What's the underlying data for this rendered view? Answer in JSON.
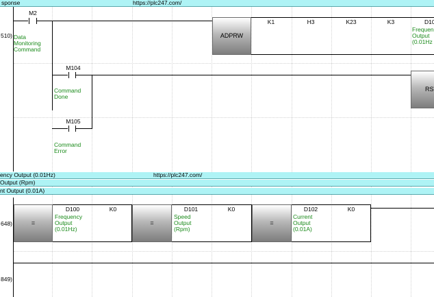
{
  "comment_bands": {
    "top": {
      "left": "sponse",
      "url": "https://plc247.com/"
    },
    "mid1": {
      "left": "ency Output (0.01Hz)",
      "url": "https://plc247.com/"
    },
    "mid2": {
      "left": " Output (Rpm)"
    },
    "mid3": {
      "left": "nt Output (0.01A)"
    }
  },
  "rung1": {
    "step": "510)",
    "contact_m2": "M2",
    "comment_m2": [
      "Data",
      "Monitoring",
      "Command"
    ],
    "instr": "ADPRW",
    "operands": [
      "K1",
      "H3",
      "K23",
      "K3",
      "D10"
    ],
    "dest_comment": [
      "Frequen",
      "Output",
      "(0.01Hz"
    ]
  },
  "rung2": {
    "contact_m104": "M104",
    "comment_m104": [
      "Command",
      "Done"
    ],
    "coil": "RST",
    "contact_m105": "M105",
    "comment_m105": [
      "Command",
      "Error"
    ]
  },
  "rung3": {
    "step": "648)",
    "cmp1": {
      "op": "=",
      "dev": "D100",
      "k": "K0",
      "comment": [
        "Frequency",
        "Output",
        "(0.01Hz)"
      ]
    },
    "cmp2": {
      "op": "=",
      "dev": "D101",
      "k": "K0",
      "comment": [
        "Speed",
        "Output",
        "(Rpm)"
      ]
    },
    "cmp3": {
      "op": "=",
      "dev": "D102",
      "k": "K0",
      "comment": [
        "Current",
        "Output",
        "(0.01A)"
      ]
    }
  },
  "rung4": {
    "step": "849)"
  }
}
